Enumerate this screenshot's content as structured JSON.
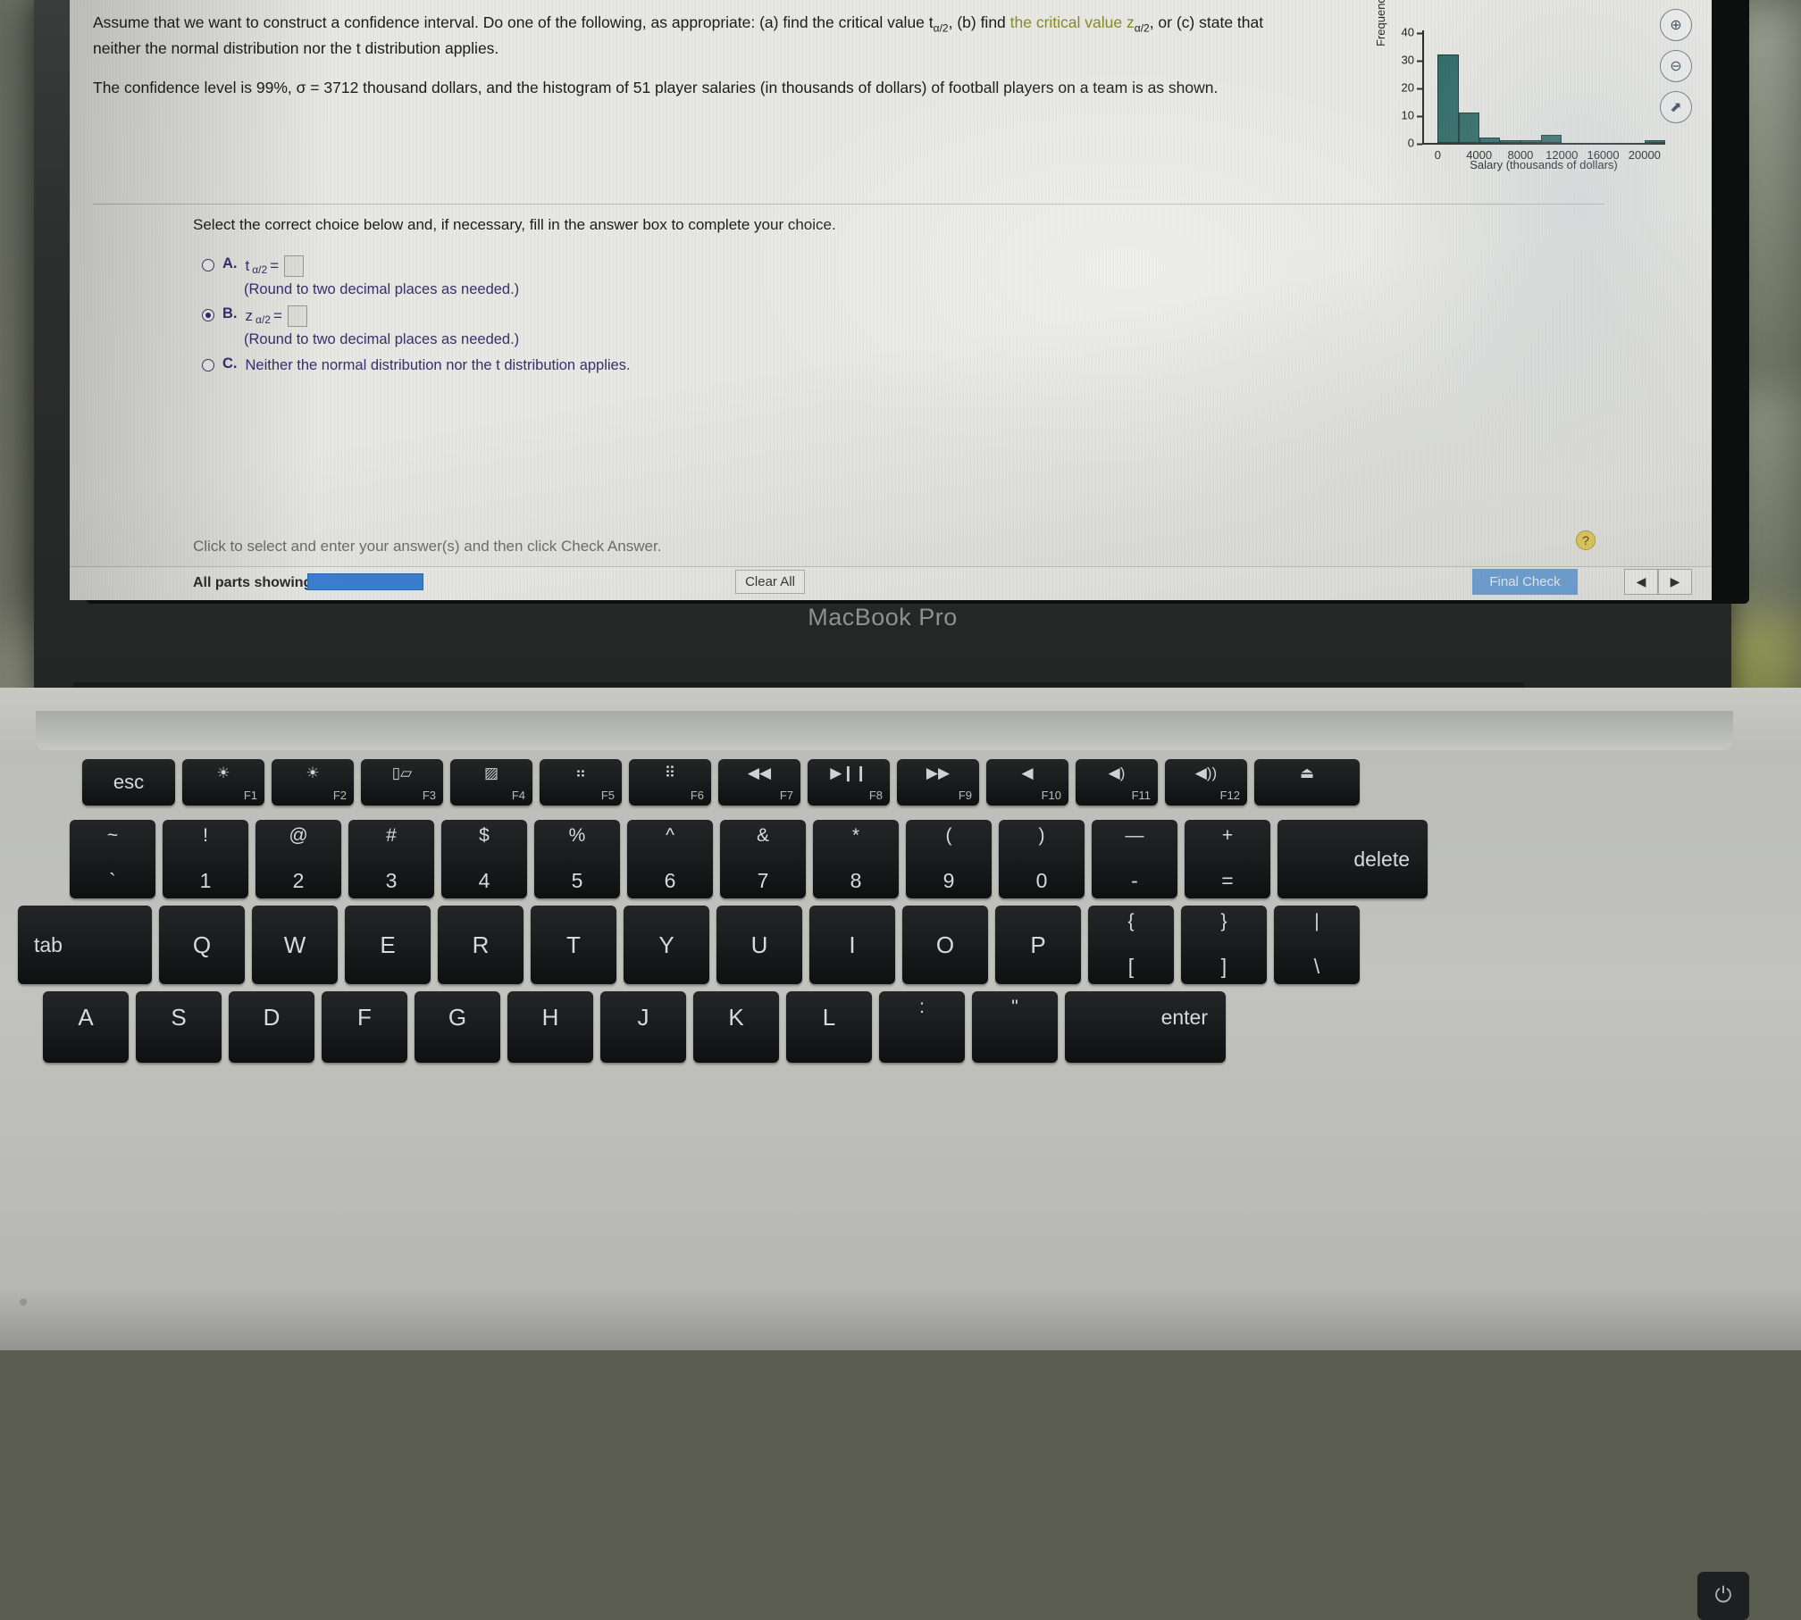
{
  "scene": {
    "laptop_label": "MacBook Pro"
  },
  "question": {
    "paragraph1_a": "Assume that we want to construct a confidence interval. Do one of the following, as appropriate: (a) find the critical value t",
    "paragraph1_sub1": "α/2",
    "paragraph1_b": ", (b) find ",
    "paragraph1_hl": "the critical value z",
    "paragraph1_sub2": "α/2",
    "paragraph1_c": ", or (c) state that neither the normal distribution nor the t distribution applies.",
    "paragraph2": "The confidence level is 99%, σ = 3712 thousand dollars, and the histogram of 51 player salaries (in thousands of dollars) of football players on a team is as shown."
  },
  "prompt": "Select the correct choice below and, if necessary, fill in the answer box to complete your choice.",
  "choices": [
    {
      "letter": "A.",
      "selected": false,
      "var": "t",
      "sub": "α/2",
      "eq": "=",
      "note": "(Round to two decimal places as needed.)",
      "text": ""
    },
    {
      "letter": "B.",
      "selected": true,
      "var": "z",
      "sub": "α/2",
      "eq": "=",
      "note": "(Round to two decimal places as needed.)",
      "text": ""
    },
    {
      "letter": "C.",
      "selected": false,
      "var": "",
      "sub": "",
      "eq": "",
      "note": "",
      "text": "Neither the normal distribution nor the t distribution applies."
    }
  ],
  "answer_input_value": "",
  "chart_data": {
    "type": "bar",
    "title": "",
    "xlabel": "Salary (thousands of dollars)",
    "ylabel": "Frequency",
    "bin_width": 2000,
    "bin_starts": [
      0,
      2000,
      4000,
      6000,
      8000,
      10000,
      12000,
      14000,
      16000,
      18000,
      20000
    ],
    "values": [
      32,
      11,
      2,
      1,
      1,
      3,
      0,
      0,
      0,
      0,
      1
    ],
    "xticks": [
      "0",
      "4000",
      "8000",
      "12000",
      "16000",
      "20000"
    ],
    "xtick_values": [
      0,
      4000,
      8000,
      12000,
      16000,
      20000
    ],
    "yticks": [
      "0",
      "10",
      "20",
      "30",
      "40"
    ],
    "ytick_values": [
      0,
      10,
      20,
      30,
      40
    ],
    "ylim": [
      0,
      40
    ],
    "xlim": [
      -1500,
      22000
    ],
    "grid": false,
    "legend": "none",
    "bar_color": "#2f6b66"
  },
  "tools": [
    {
      "name": "zoom-in",
      "glyph": "⊕"
    },
    {
      "name": "zoom-out",
      "glyph": "⊖"
    },
    {
      "name": "open-in-new-window",
      "glyph": "⬈"
    }
  ],
  "footer": {
    "hint": "Click to select and enter your answer(s) and then click Check Answer.",
    "help_glyph": "?",
    "all_parts_label": "All parts showing",
    "clear_all_label": "Clear All",
    "final_check_label": "Final Check",
    "prev_glyph": "◀",
    "next_glyph": "▶"
  },
  "keyboard": {
    "row_fn": [
      {
        "name": "esc",
        "main": "esc",
        "fn": ""
      },
      {
        "name": "brightness-down",
        "main": "☀",
        "fn": "F1"
      },
      {
        "name": "brightness-up",
        "main": "☀",
        "fn": "F2"
      },
      {
        "name": "mission-control",
        "main": "▯▱",
        "fn": "F3"
      },
      {
        "name": "launchpad",
        "main": "▨",
        "fn": "F4"
      },
      {
        "name": "keyboard-light-down",
        "main": "⠶",
        "fn": "F5"
      },
      {
        "name": "keyboard-light-up",
        "main": "⠿",
        "fn": "F6"
      },
      {
        "name": "rewind",
        "main": "◀◀",
        "fn": "F7"
      },
      {
        "name": "play-pause",
        "main": "▶❙❙",
        "fn": "F8"
      },
      {
        "name": "fast-forward",
        "main": "▶▶",
        "fn": "F9"
      },
      {
        "name": "mute",
        "main": "◀",
        "fn": "F10"
      },
      {
        "name": "volume-down",
        "main": "◀)",
        "fn": "F11"
      },
      {
        "name": "volume-up",
        "main": "◀))",
        "fn": "F12"
      },
      {
        "name": "eject",
        "main": "⏏",
        "fn": ""
      }
    ],
    "row_number": [
      {
        "name": "tilde",
        "top": "~",
        "bottom": "`"
      },
      {
        "name": "one",
        "top": "!",
        "bottom": "1"
      },
      {
        "name": "two",
        "top": "@",
        "bottom": "2"
      },
      {
        "name": "three",
        "top": "#",
        "bottom": "3"
      },
      {
        "name": "four",
        "top": "$",
        "bottom": "4"
      },
      {
        "name": "five",
        "top": "%",
        "bottom": "5"
      },
      {
        "name": "six",
        "top": "^",
        "bottom": "6"
      },
      {
        "name": "seven",
        "top": "&",
        "bottom": "7"
      },
      {
        "name": "eight",
        "top": "*",
        "bottom": "8"
      },
      {
        "name": "nine",
        "top": "(",
        "bottom": "9"
      },
      {
        "name": "zero",
        "top": ")",
        "bottom": "0"
      },
      {
        "name": "minus",
        "top": "—",
        "bottom": "-"
      },
      {
        "name": "equals",
        "top": "+",
        "bottom": "="
      }
    ],
    "delete_label": "delete",
    "tab_label": "tab",
    "row_qwerty": [
      "Q",
      "W",
      "E",
      "R",
      "T",
      "Y",
      "U",
      "I",
      "O",
      "P"
    ],
    "bracket_left": {
      "top": "{",
      "bottom": "["
    },
    "bracket_right": {
      "top": "}",
      "bottom": "]"
    },
    "backslash": {
      "top": "|",
      "bottom": "\\"
    },
    "row_asdf": [
      "A",
      "S",
      "D",
      "F",
      "G",
      "H",
      "J",
      "K",
      "L"
    ],
    "semicolon": {
      "top": ":",
      "bottom": ";"
    },
    "quote": {
      "top": "\"",
      "bottom": "'"
    },
    "enter_label": "enter",
    "power_glyph": "⏻"
  }
}
